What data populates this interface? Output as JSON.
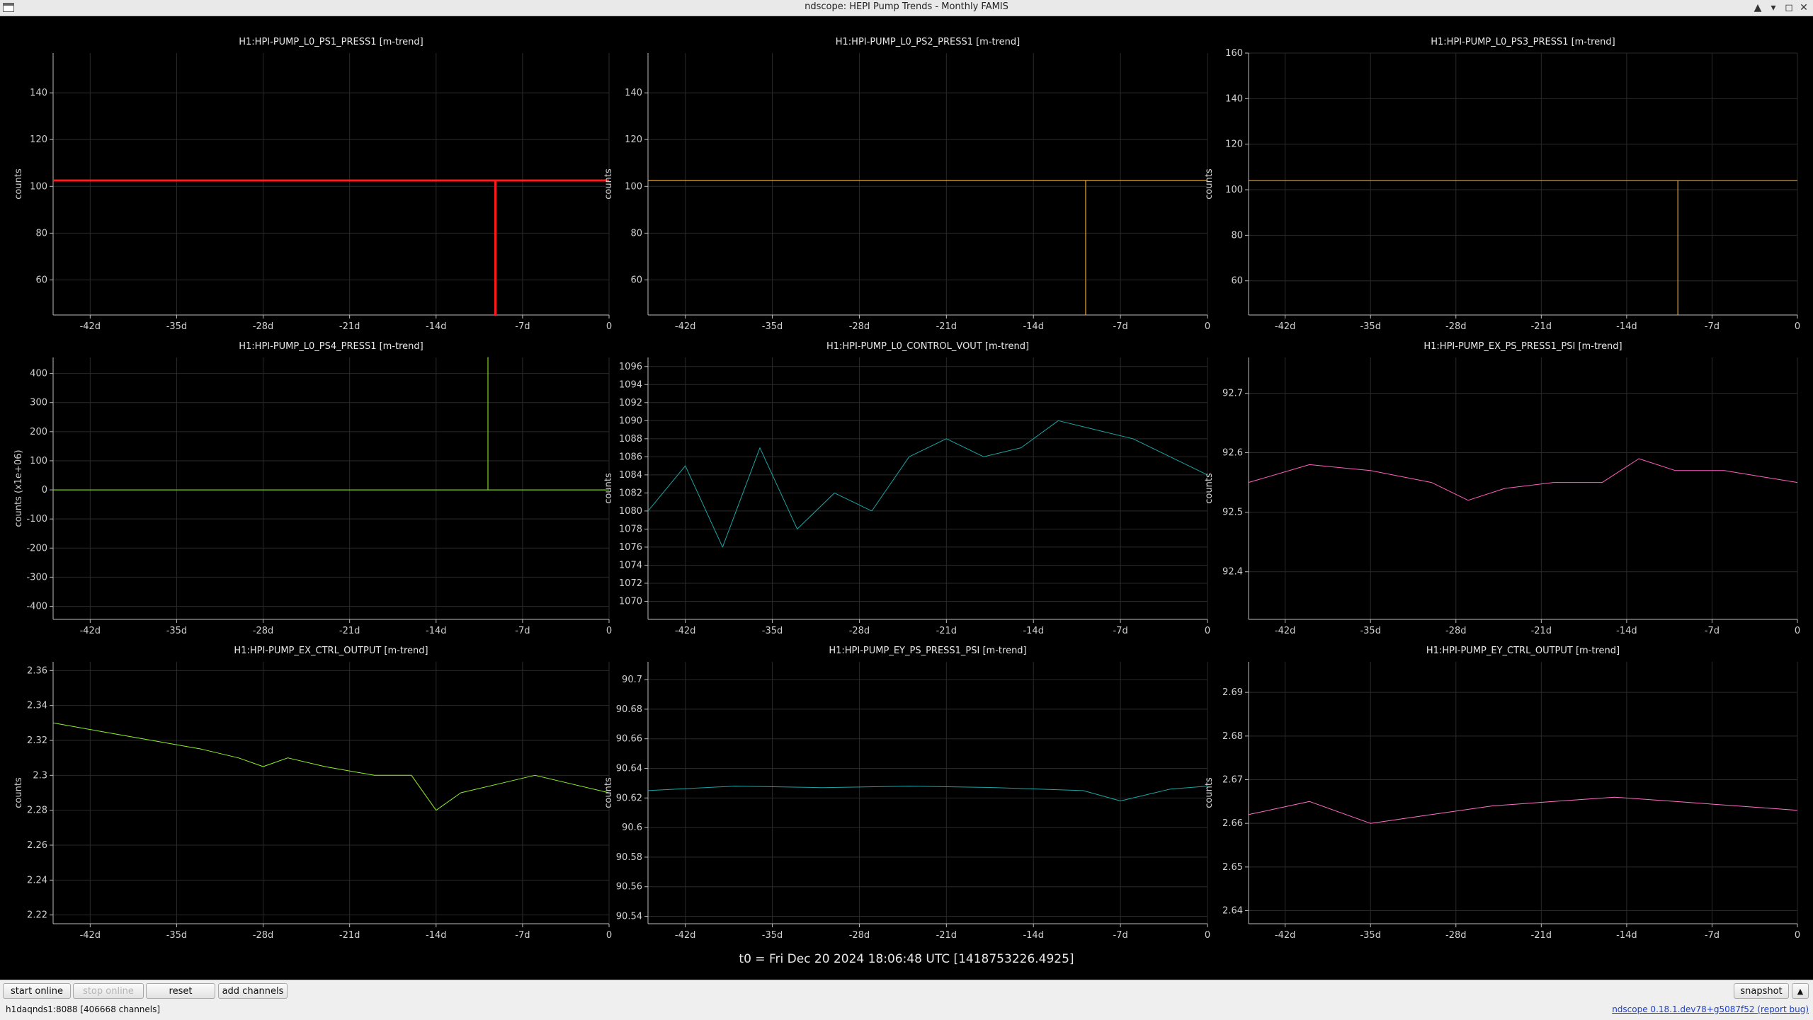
{
  "window": {
    "title": "ndscope: HEPI Pump Trends - Monthly FAMIS",
    "buttons": [
      "▲",
      "▾",
      "◻",
      "✕"
    ]
  },
  "time_axis": {
    "tick_values": [
      -42,
      -35,
      -28,
      -21,
      -14,
      -7,
      0
    ],
    "tick_labels": [
      "-42d",
      "-35d",
      "-28d",
      "-21d",
      "-14d",
      "-7d",
      "0"
    ],
    "range": [
      -45,
      0
    ]
  },
  "t0_label": "t0 = Fri Dec 20 2024 18:06:48 UTC [1418753226.4925]",
  "toolbar": {
    "start_online": "start online",
    "stop_online": "stop online",
    "reset": "reset",
    "add_channels": "add channels",
    "snapshot": "snapshot",
    "expand_icon": "▲"
  },
  "status": {
    "server": "h1daqnds1:8088  [406668 channels]",
    "version": "ndscope 0.18.1.dev78+g5087f52",
    "report_bug": "(report bug)"
  },
  "chart_data": [
    {
      "type": "line",
      "title": "H1:HPI-PUMP_L0_PS1_PRESS1 [m-trend]",
      "ylabel": "counts",
      "color": "#ff1a1a",
      "line_width": 3,
      "ylim": [
        45,
        157
      ],
      "yticks": [
        60,
        80,
        100,
        120,
        140
      ],
      "ytick_labels": [
        "60",
        "80",
        "100",
        "120",
        "140"
      ],
      "series": [
        {
          "x": [
            -45,
            -9.2,
            -9.2,
            -9.2,
            0
          ],
          "y": [
            102.5,
            102.5,
            45,
            102.5,
            102.5
          ]
        }
      ]
    },
    {
      "type": "line",
      "title": "H1:HPI-PUMP_L0_PS2_PRESS1 [m-trend]",
      "ylabel": "counts",
      "color": "#f2a62c",
      "line_width": 1.2,
      "ylim": [
        45,
        157
      ],
      "yticks": [
        60,
        80,
        100,
        120,
        140
      ],
      "ytick_labels": [
        "60",
        "80",
        "100",
        "120",
        "140"
      ],
      "series": [
        {
          "x": [
            -45,
            -9.8,
            -9.8,
            -9.8,
            0
          ],
          "y": [
            102.5,
            102.5,
            45,
            102.5,
            102.5
          ]
        }
      ]
    },
    {
      "type": "line",
      "title": "H1:HPI-PUMP_L0_PS3_PRESS1 [m-trend]",
      "ylabel": "counts",
      "color": "#f2a62c",
      "line_width": 1.2,
      "ylim": [
        45,
        160
      ],
      "yticks": [
        60,
        80,
        100,
        120,
        140,
        160
      ],
      "ytick_labels": [
        "60",
        "80",
        "100",
        "120",
        "140",
        "160"
      ],
      "series": [
        {
          "x": [
            -45,
            -9.8,
            -9.8,
            -9.8,
            0
          ],
          "y": [
            104,
            104,
            45,
            104,
            104
          ]
        }
      ]
    },
    {
      "type": "line",
      "title": "H1:HPI-PUMP_L0_PS4_PRESS1 [m-trend]",
      "ylabel": "counts (x1e+06)",
      "color": "#7ed321",
      "line_width": 1.2,
      "ylim": [
        -445,
        455
      ],
      "yticks": [
        -400,
        -300,
        -200,
        -100,
        0,
        100,
        200,
        300,
        400
      ],
      "ytick_labels": [
        "-400",
        "-300",
        "-200",
        "-100",
        "0",
        "100",
        "200",
        "300",
        "400"
      ],
      "series": [
        {
          "x": [
            -45,
            -9.8,
            -9.8,
            -9.8,
            0
          ],
          "y": [
            0,
            0,
            455,
            0,
            0
          ]
        }
      ]
    },
    {
      "type": "line",
      "title": "H1:HPI-PUMP_L0_CONTROL_VOUT [m-trend]",
      "ylabel": "counts",
      "color": "#1aa6a6",
      "line_width": 1,
      "ylim": [
        1068,
        1097
      ],
      "yticks": [
        1070,
        1072,
        1074,
        1076,
        1078,
        1080,
        1082,
        1084,
        1086,
        1088,
        1090,
        1092,
        1094,
        1096
      ],
      "ytick_labels": [
        "1070",
        "1072",
        "1074",
        "1076",
        "1078",
        "1080",
        "1082",
        "1084",
        "1086",
        "1088",
        "1090",
        "1092",
        "1094",
        "1096"
      ],
      "series": [
        {
          "x": [
            -45,
            -42,
            -39,
            -36,
            -33,
            -30,
            -27,
            -24,
            -21,
            -18,
            -15,
            -12,
            -9,
            -6,
            -3,
            0
          ],
          "y": [
            1080,
            1085,
            1076,
            1087,
            1078,
            1082,
            1080,
            1086,
            1088,
            1086,
            1087,
            1090,
            1089,
            1088,
            1086,
            1084
          ]
        }
      ]
    },
    {
      "type": "line",
      "title": "H1:HPI-PUMP_EX_PS_PRESS1_PSI [m-trend]",
      "ylabel": "counts",
      "color": "#ff5fbf",
      "line_width": 1,
      "ylim": [
        92.32,
        92.76
      ],
      "yticks": [
        92.4,
        92.5,
        92.6,
        92.7
      ],
      "ytick_labels": [
        "92.4",
        "92.5",
        "92.6",
        "92.7"
      ],
      "series": [
        {
          "x": [
            -45,
            -40,
            -35,
            -30,
            -27,
            -24,
            -20,
            -16,
            -13,
            -10,
            -6,
            -3,
            0
          ],
          "y": [
            92.55,
            92.58,
            92.57,
            92.55,
            92.52,
            92.54,
            92.55,
            92.55,
            92.59,
            92.57,
            92.57,
            92.56,
            92.55
          ]
        }
      ]
    },
    {
      "type": "line",
      "title": "H1:HPI-PUMP_EX_CTRL_OUTPUT [m-trend]",
      "ylabel": "counts",
      "color": "#8ef22a",
      "line_width": 1,
      "ylim": [
        2.215,
        2.365
      ],
      "yticks": [
        2.22,
        2.24,
        2.26,
        2.28,
        2.3,
        2.32,
        2.34,
        2.36
      ],
      "ytick_labels": [
        "2.22",
        "2.24",
        "2.26",
        "2.28",
        "2.3",
        "2.32",
        "2.34",
        "2.36"
      ],
      "series": [
        {
          "x": [
            -45,
            -41,
            -37,
            -33,
            -30,
            -28,
            -26,
            -23,
            -19,
            -16,
            -14,
            -12,
            -9,
            -6,
            -3,
            0
          ],
          "y": [
            2.33,
            2.325,
            2.32,
            2.315,
            2.31,
            2.305,
            2.31,
            2.305,
            2.3,
            2.3,
            2.28,
            2.29,
            2.295,
            2.3,
            2.295,
            2.29
          ]
        }
      ]
    },
    {
      "type": "line",
      "title": "H1:HPI-PUMP_EY_PS_PRESS1_PSI [m-trend]",
      "ylabel": "counts",
      "color": "#1aa6a6",
      "line_width": 1,
      "ylim": [
        90.535,
        90.712
      ],
      "yticks": [
        90.54,
        90.56,
        90.58,
        90.6,
        90.62,
        90.64,
        90.66,
        90.68,
        90.7
      ],
      "ytick_labels": [
        "90.54",
        "90.56",
        "90.58",
        "90.6",
        "90.62",
        "90.64",
        "90.66",
        "90.68",
        "90.7"
      ],
      "series": [
        {
          "x": [
            -45,
            -38,
            -31,
            -24,
            -17,
            -10,
            -7,
            -3,
            0
          ],
          "y": [
            90.625,
            90.628,
            90.627,
            90.628,
            90.627,
            90.625,
            90.618,
            90.626,
            90.628
          ]
        }
      ]
    },
    {
      "type": "line",
      "title": "H1:HPI-PUMP_EY_CTRL_OUTPUT [m-trend]",
      "ylabel": "counts",
      "color": "#ff6ec7",
      "line_width": 1,
      "ylim": [
        2.637,
        2.697
      ],
      "yticks": [
        2.64,
        2.65,
        2.66,
        2.67,
        2.68,
        2.69
      ],
      "ytick_labels": [
        "2.64",
        "2.65",
        "2.66",
        "2.67",
        "2.68",
        "2.69"
      ],
      "series": [
        {
          "x": [
            -45,
            -40,
            -35,
            -30,
            -25,
            -20,
            -15,
            -10,
            -5,
            0
          ],
          "y": [
            2.662,
            2.665,
            2.66,
            2.662,
            2.664,
            2.665,
            2.666,
            2.665,
            2.664,
            2.663
          ]
        }
      ]
    }
  ]
}
